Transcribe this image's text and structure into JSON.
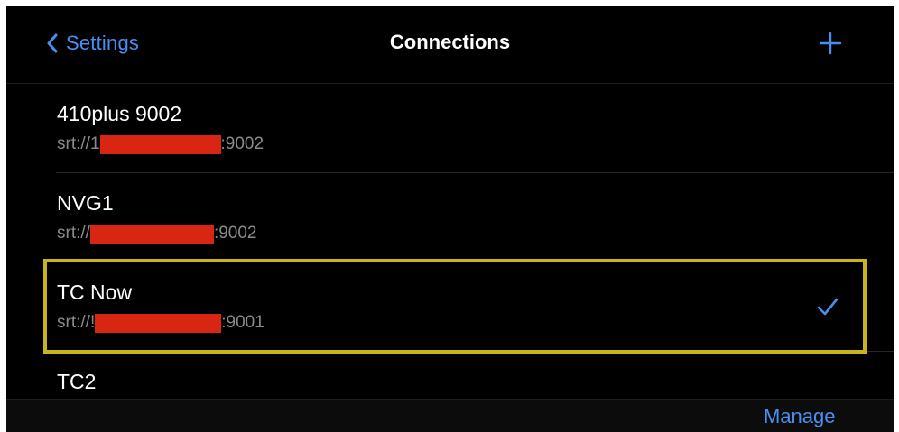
{
  "navbar": {
    "back_label": "Settings",
    "title": "Connections",
    "add_icon": "plus-icon",
    "back_icon": "chevron-left-icon"
  },
  "connections": [
    {
      "name": "410plus 9002",
      "url_prefix": "srt://1",
      "url_suffix": ":9002",
      "selected": false
    },
    {
      "name": "NVG1",
      "url_prefix": "srt://",
      "url_suffix": ":9002",
      "selected": false
    },
    {
      "name": "TC Now",
      "url_prefix": "srt://!",
      "url_suffix": ":9001",
      "selected": true
    },
    {
      "name": "TC2",
      "url_prefix": "",
      "url_suffix": "",
      "selected": false
    }
  ],
  "toolbar": {
    "manage_label": "Manage"
  },
  "colors": {
    "accent": "#4a8ef0",
    "background": "#000000",
    "redaction": "#d92612",
    "highlight": "#cbb31a"
  }
}
